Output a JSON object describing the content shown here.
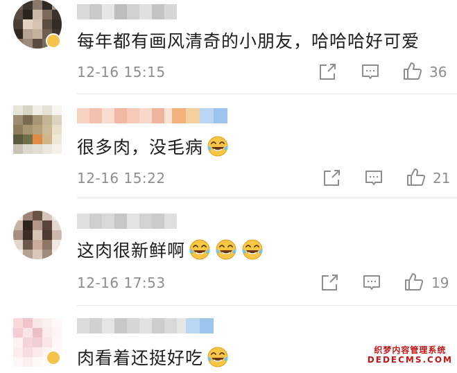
{
  "comments": [
    {
      "text": "每年都有画风清奇的小朋友，哈哈哈好可爱",
      "time": "12-16 15:15",
      "likes": "36",
      "emoji_count": 0,
      "avatar_colors": [
        "#6b5a4e",
        "#3d3430",
        "#8a7a6d",
        "#2e2925",
        "#a39587",
        "#574a40",
        "#2b2521",
        "#c9b8a8",
        "#7d6a5c",
        "#3a322c",
        "#4a3f37",
        "#e3d2c0",
        "#d6c2ae",
        "#5c4d42",
        "#332b26",
        "#2f2823",
        "#b7a493",
        "#c4b09c",
        "#6e5d50",
        "#403630",
        "#8a7868",
        "#9d8a79",
        "#5b4c41",
        "#7a6a5d",
        "#ffffff"
      ]
    },
    {
      "text": "很多肉，没毛病",
      "time": "12-16 15:22",
      "likes": "21",
      "emoji_count": 1,
      "avatar_colors": [
        "#e9e4da",
        "#d9d3c6",
        "#f1eee8",
        "#e6e1d7",
        "#f7f5f1",
        "#9b8d72",
        "#7b6a52",
        "#a69473",
        "#c4b394",
        "#dcd2bd",
        "#8f7e5e",
        "#a7956f",
        "#b5a27c",
        "#cbb895",
        "#e8dfc9",
        "#5b5a3c",
        "#6f7049",
        "#e08a47",
        "#d0b48a",
        "#efe8d6",
        "#c9c4b4",
        "#dcd8cc",
        "#e2ddd1",
        "#ebe7de",
        "#f4f1ea"
      ]
    },
    {
      "text": "这肉很新鲜啊",
      "time": "12-16 17:53",
      "likes": "19",
      "emoji_count": 3,
      "avatar_colors": [
        "#f0ebe6",
        "#9c8578",
        "#6b5247",
        "#d6c5b8",
        "#efe9e4",
        "#c7b3a5",
        "#2f231e",
        "#b3988a",
        "#5a443b",
        "#e4d9d0",
        "#a88e80",
        "#3b2c26",
        "#d8c2b2",
        "#4d3a32",
        "#cbb8aa",
        "#e3d6cb",
        "#6e584d",
        "#c9ad9a",
        "#8f7667",
        "#f0e8e1",
        "#f3eee9",
        "#b6a193",
        "#d9c7b9",
        "#a08a7c",
        "#f6f2ee"
      ]
    },
    {
      "text": "肉看着还挺好吃",
      "time": "",
      "likes": "",
      "emoji_count": 1,
      "avatar_colors": [
        "#f7d9dc",
        "#f2c4c9",
        "#f9e6e8",
        "#fbeff0",
        "#fff7f8",
        "#f5ced3",
        "#f9e3e6",
        "#eec0c6",
        "#fbecee",
        "#fff5f6",
        "#fdf1f2",
        "#f5d5d9",
        "#f0cfd3",
        "#fae5e8",
        "#fffafa",
        "#fcecee",
        "#f8dde0",
        "#fce9eb",
        "#fff3f4",
        "#fffafb",
        "#fef6f7",
        "#fdf0f2",
        "#fff8f9",
        "#fffbfb",
        "#ffffff"
      ]
    }
  ],
  "name_bars": [
    [
      "#d9d9d9",
      "#c9c9c9",
      "#e6e6e6",
      "#bdbdbd",
      "#d1d1d1",
      "#e0e0e0",
      "#c4c4c4",
      "#d6d6d6"
    ],
    [
      "#f6d2c2",
      "#f3c1ad",
      "#f8dccf",
      "#f1b9a4",
      "#f5cab8",
      "#f7d7c9",
      "#efb49d",
      "#f9e2d6",
      "#f4c7b5",
      "#f0bfa9"
    ],
    [
      "#e0e0e0",
      "#cfcfcf",
      "#d8d8d8",
      "#c6c6c6",
      "#e3e3e3",
      "#d2d2d2",
      "#cbcbcb",
      "#dedede"
    ],
    [
      "#dcdcdc",
      "#d0d0d0",
      "#e4e4e4",
      "#c8c8c8",
      "#d6d6d6",
      "#e1e1e1",
      "#cdcdcd",
      "#d9d9d9",
      "#e6e6e6",
      "#d3d3d3"
    ]
  ],
  "badge_colors": {
    "vip_blue": "#9cc5ee",
    "vip_orange": "#f3b27a",
    "verified_gold": "#f5c24a"
  },
  "icons": {
    "share": "share-icon",
    "comment": "comment-icon",
    "like": "like-icon",
    "emoji": "laugh-cry-emoji-icon"
  },
  "watermark": {
    "line1": "织梦内容管理系统",
    "line2": "DEDECMS.COM"
  }
}
